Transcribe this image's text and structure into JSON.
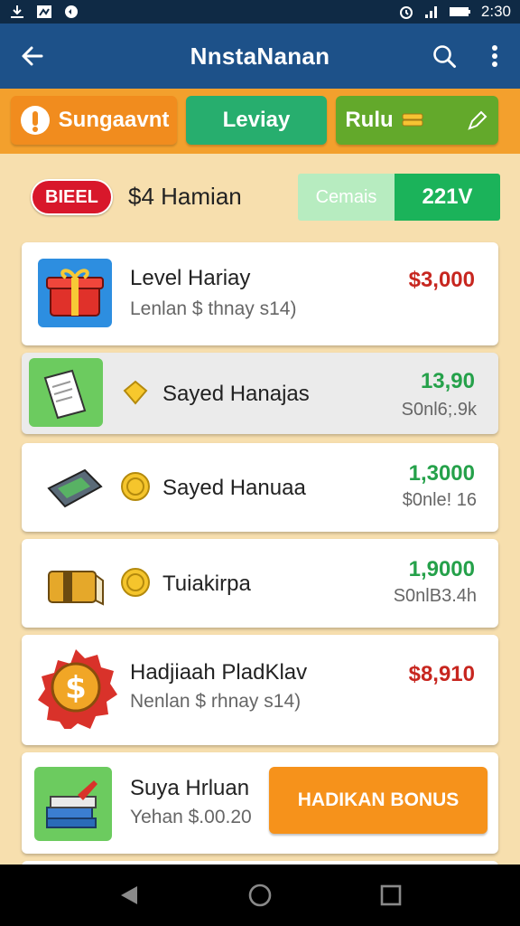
{
  "status_bar": {
    "time": "2:30",
    "icons": [
      "download-icon",
      "app-icon",
      "sync-icon",
      "alarm-icon",
      "signal-icon",
      "battery-icon"
    ]
  },
  "app_bar": {
    "title": "NnstaNanan",
    "back_icon": "arrow-left-icon",
    "search_icon": "search-icon",
    "menu_icon": "more-vertical-icon"
  },
  "tabs": [
    {
      "label": "Sungaavnt",
      "icon": "info-icon",
      "color": "#f18c1e"
    },
    {
      "label": "Leviay",
      "color": "#27ae6e"
    },
    {
      "label": "Rulu",
      "icon": "coins-icon",
      "trailing_icon": "edit-icon",
      "color": "#63a92b"
    }
  ],
  "summary": {
    "badge": "BIEEL",
    "title": "$4 Hamian",
    "seg_left": "Cemais",
    "seg_right": "221V"
  },
  "items": [
    {
      "icon": "gift-icon",
      "title": "Level Hariay",
      "subtitle": "Lenlan $ thnay s14)",
      "amount": "$3,000",
      "amount_color": "red"
    },
    {
      "icon": "card-icon",
      "coin": "gem-icon",
      "title": "Sayed Hanajas",
      "amount": "13,90",
      "subtitle2": "S0nl6;.9k",
      "amount_color": "green"
    },
    {
      "icon": "wallet-icon",
      "coin": "coin-icon",
      "title": "Sayed Hanuaa",
      "amount": "1,3000",
      "subtitle2": "$0nle! 16",
      "amount_color": "green"
    },
    {
      "icon": "cash-stack-icon",
      "coin": "coin-icon",
      "title": "Tuiakirpa",
      "amount": "1,9000",
      "subtitle2": "S0nlB3.4h",
      "amount_color": "green"
    },
    {
      "icon": "dollar-badge-icon",
      "title": "Hadjiaah PladKlav",
      "subtitle": "Nenlan $ rhnay s14)",
      "amount": "$8,910",
      "amount_color": "red"
    },
    {
      "icon": "books-icon",
      "title": "Suya Hrluan",
      "subtitle": "Yehan $.00.20",
      "button": "HADIKAN BONUS"
    }
  ],
  "colors": {
    "appbar": "#1d5189",
    "accent": "#f3a02d",
    "green": "#1bb35a",
    "red": "#d8172b",
    "background": "#f7dfae"
  },
  "nav_bar": {
    "back": "triangle-back-icon",
    "home": "circle-home-icon",
    "recent": "square-recent-icon"
  }
}
